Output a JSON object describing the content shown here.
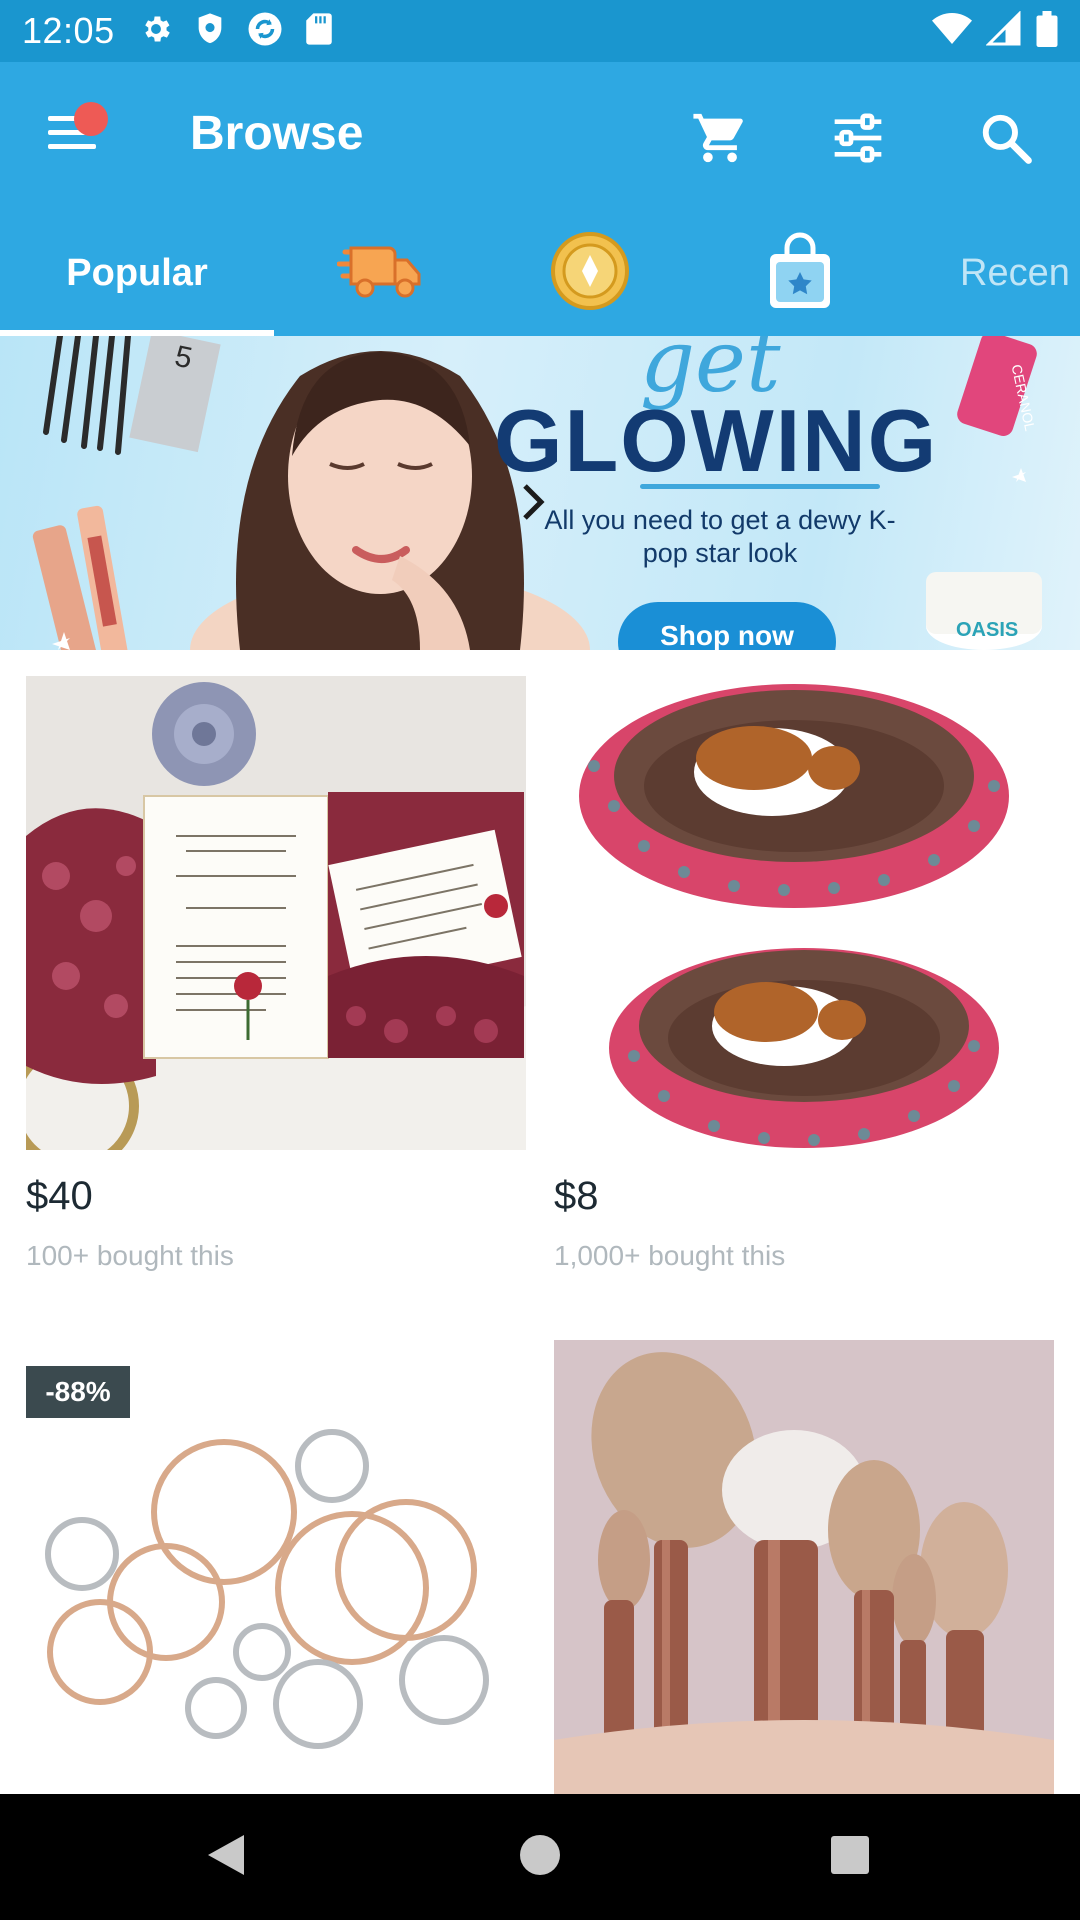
{
  "status_bar": {
    "time": "12:05",
    "left_icons": [
      "settings-icon",
      "shield-icon",
      "sync-icon",
      "sd-card-icon"
    ],
    "right_icons": [
      "wifi-icon",
      "cell-signal-icon",
      "battery-icon"
    ]
  },
  "app_bar": {
    "title": "Browse",
    "menu_has_notification": true,
    "actions": [
      "cart-icon",
      "filter-icon",
      "search-icon"
    ]
  },
  "tabs": [
    {
      "label": "Popular",
      "selected": true
    },
    {
      "icon": "delivery-truck-icon"
    },
    {
      "icon": "gold-coin-icon"
    },
    {
      "icon": "shopping-bag-star-icon"
    },
    {
      "label": "Recen"
    }
  ],
  "banner": {
    "script_text": "get",
    "headline": "GLOWING",
    "subtitle": "All you need to get a dewy K-pop star look",
    "cta": "Shop now",
    "product_labels": [
      "5",
      "CERANOL",
      "OASIS"
    ]
  },
  "products": [
    {
      "price": "$40",
      "bought": "100+ bought this",
      "image": "wedding-invitation"
    },
    {
      "price": "$8",
      "bought": "1,000+ bought this",
      "image": "pet-bed"
    },
    {
      "discount": "-88%",
      "image": "metal-rings"
    },
    {
      "image": "makeup-brushes"
    }
  ],
  "nav_bar": [
    "back-icon",
    "home-icon",
    "recents-icon"
  ],
  "colors": {
    "status_bar": "#1a96cf",
    "app_bar": "#2ea8e2",
    "notification_dot": "#ee5a55",
    "banner_headline": "#133b73",
    "banner_cta": "#1a8fd6",
    "discount_badge": "#3b4a4f"
  }
}
